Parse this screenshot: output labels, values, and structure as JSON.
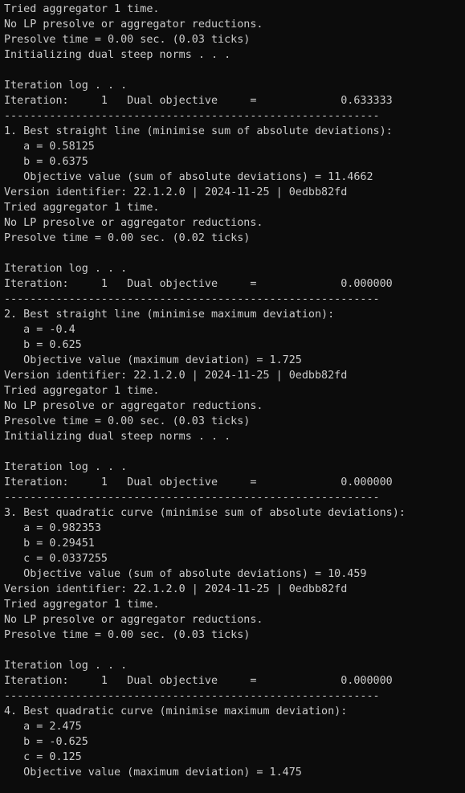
{
  "terminal": {
    "lines": [
      "Tried aggregator 1 time.",
      "No LP presolve or aggregator reductions.",
      "Presolve time = 0.00 sec. (0.03 ticks)",
      "Initializing dual steep norms . . .",
      "",
      "Iteration log . . .",
      "Iteration:     1   Dual objective     =             0.633333",
      "----------------------------------------------------------",
      "1. Best straight line (minimise sum of absolute deviations):",
      "   a = 0.58125",
      "   b = 0.6375",
      "   Objective value (sum of absolute deviations) = 11.4662",
      "Version identifier: 22.1.2.0 | 2024-11-25 | 0edbb82fd",
      "Tried aggregator 1 time.",
      "No LP presolve or aggregator reductions.",
      "Presolve time = 0.00 sec. (0.02 ticks)",
      "",
      "Iteration log . . .",
      "Iteration:     1   Dual objective     =             0.000000",
      "----------------------------------------------------------",
      "2. Best straight line (minimise maximum deviation):",
      "   a = -0.4",
      "   b = 0.625",
      "   Objective value (maximum deviation) = 1.725",
      "Version identifier: 22.1.2.0 | 2024-11-25 | 0edbb82fd",
      "Tried aggregator 1 time.",
      "No LP presolve or aggregator reductions.",
      "Presolve time = 0.00 sec. (0.03 ticks)",
      "Initializing dual steep norms . . .",
      "",
      "Iteration log . . .",
      "Iteration:     1   Dual objective     =             0.000000",
      "----------------------------------------------------------",
      "3. Best quadratic curve (minimise sum of absolute deviations):",
      "   a = 0.982353",
      "   b = 0.29451",
      "   c = 0.0337255",
      "   Objective value (sum of absolute deviations) = 10.459",
      "Version identifier: 22.1.2.0 | 2024-11-25 | 0edbb82fd",
      "Tried aggregator 1 time.",
      "No LP presolve or aggregator reductions.",
      "Presolve time = 0.00 sec. (0.03 ticks)",
      "",
      "Iteration log . . .",
      "Iteration:     1   Dual objective     =             0.000000",
      "----------------------------------------------------------",
      "4. Best quadratic curve (minimise maximum deviation):",
      "   a = 2.475",
      "   b = -0.625",
      "   c = 0.125",
      "   Objective value (maximum deviation) = 1.475"
    ]
  }
}
